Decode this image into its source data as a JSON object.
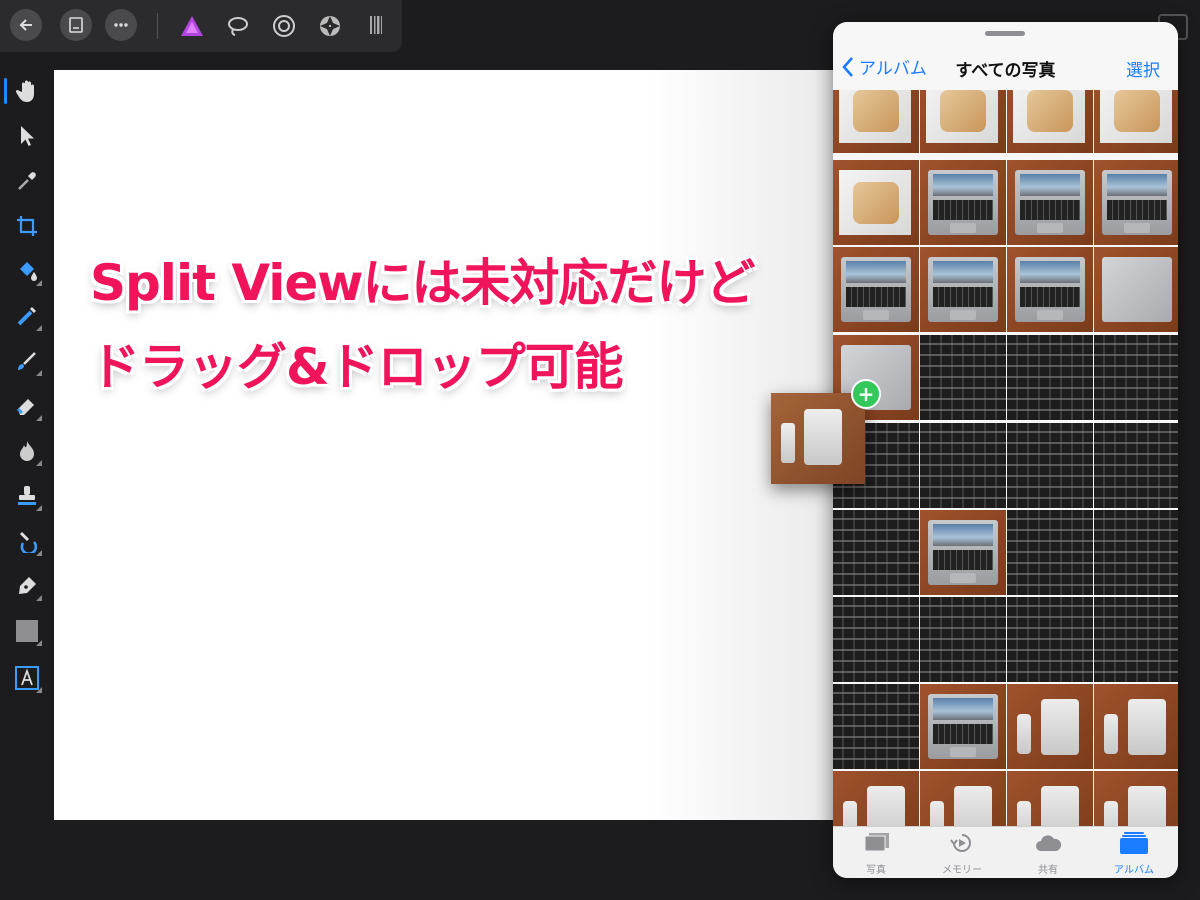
{
  "headline": {
    "line1": "Split Viewには未対応だけど",
    "line2": "ドラッグ&ドロップ可能"
  },
  "photos_panel": {
    "back_label": "アルバム",
    "title": "すべての写真",
    "select_label": "選択",
    "tabs": [
      {
        "label": "写真",
        "icon": "photos-icon",
        "selected": false
      },
      {
        "label": "メモリー",
        "icon": "memories-icon",
        "selected": false
      },
      {
        "label": "共有",
        "icon": "cloud-icon",
        "selected": false
      },
      {
        "label": "アルバム",
        "icon": "albums-icon",
        "selected": true
      }
    ]
  },
  "drag": {
    "badge": "+"
  },
  "colors": {
    "headline": "#f0145a",
    "accent": "#1a7dff",
    "add_badge": "#34c759",
    "app_background": "#1c1c1e"
  }
}
